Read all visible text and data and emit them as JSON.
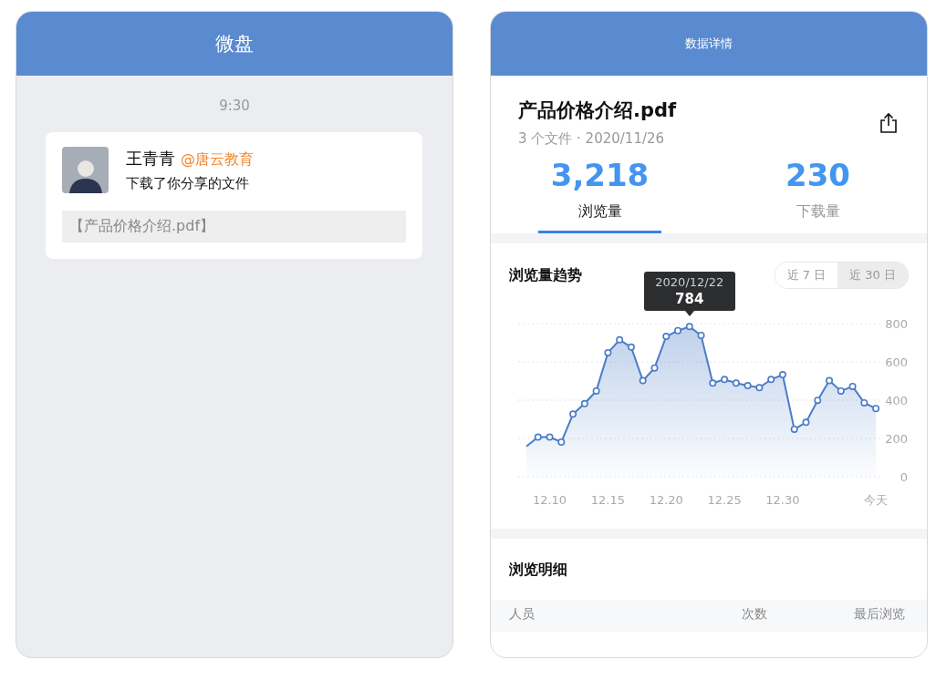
{
  "left_phone": {
    "title": "微盘",
    "time": "9:30",
    "message": {
      "name": "王青青",
      "org": "@唐云教育",
      "action": "下载了你分享的文件",
      "file": "【产品价格介绍.pdf】"
    }
  },
  "right_phone": {
    "title": "数据详情",
    "file": {
      "name": "产品价格介绍.pdf",
      "meta": "3 个文件 · 2020/11/26"
    },
    "stats": [
      {
        "value": "3,218",
        "label": "浏览量",
        "selected": true
      },
      {
        "value": "230",
        "label": "下载量",
        "selected": false
      }
    ],
    "trend": {
      "title": "浏览量趋势",
      "ranges": [
        {
          "label": "近 7 日",
          "selected": false
        },
        {
          "label": "近 30 日",
          "selected": true
        }
      ],
      "tooltip": {
        "date": "2020/12/22",
        "value": "784"
      },
      "chart_data": {
        "type": "area",
        "grid": true,
        "categories": [
          null,
          null,
          "12.10",
          null,
          null,
          null,
          null,
          "12.15",
          null,
          null,
          null,
          null,
          "12.20",
          null,
          null,
          null,
          null,
          "12.25",
          null,
          null,
          null,
          null,
          "12.30",
          null,
          null,
          null,
          null,
          null,
          null,
          null,
          "今天"
        ],
        "series": [
          {
            "color": "#4a7cc7",
            "values": [
              158,
              207,
              207,
              181,
              327,
              382,
              448,
              648,
              715,
              677,
              502,
              568,
              733,
              763,
              784,
              738,
              489,
              508,
              489,
              476,
              465,
              508,
              533,
              248,
              284,
              399,
              502,
              448,
              472,
              386,
              356
            ]
          }
        ],
        "ylim": [
          0,
          800
        ],
        "yticks": [
          0,
          200,
          400,
          600,
          800
        ]
      }
    },
    "details": {
      "title": "浏览明细",
      "columns": [
        "人员",
        "次数",
        "最后浏览"
      ]
    }
  }
}
